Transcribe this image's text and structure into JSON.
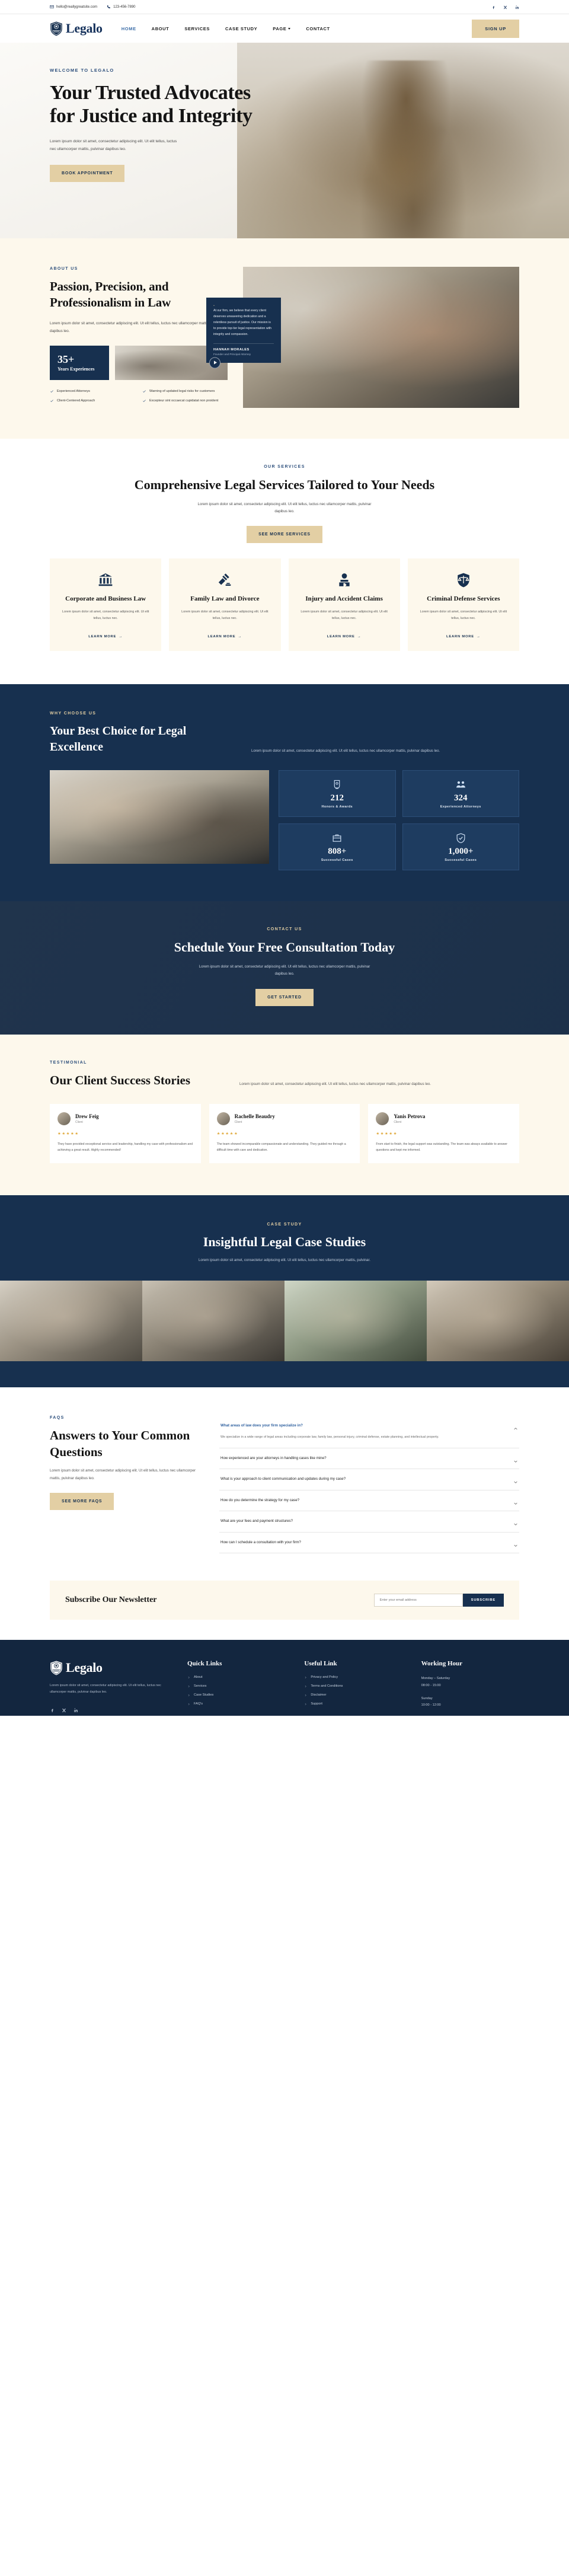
{
  "topbar": {
    "email": "hello@reallygreatsite.com",
    "phone": "123-456-7890",
    "socials": [
      "facebook-icon",
      "x-icon",
      "linkedin-icon"
    ]
  },
  "nav": {
    "brand": "Legalo",
    "links": [
      {
        "label": "HOME",
        "active": true
      },
      {
        "label": "ABOUT",
        "active": false
      },
      {
        "label": "SERVICES",
        "active": false
      },
      {
        "label": "CASE STUDY",
        "active": false
      },
      {
        "label": "PAGE",
        "active": false,
        "caret": true
      },
      {
        "label": "CONTACT",
        "active": false
      }
    ],
    "signup": "SIGN UP"
  },
  "hero": {
    "eyebrow": "WELCOME TO LEGALO",
    "title": "Your Trusted Advocates for Justice and Integrity",
    "body": "Lorem ipsum dolor sit amet, consectetur adipiscing elit. Ut elit tellus, luctus nec ullamcorper mattis, pulvinar dapibus leo.",
    "cta": "BOOK APPOINTMENT"
  },
  "about": {
    "label": "ABOUT US",
    "title": "Passion, Precision, and Professionalism in Law",
    "body": "Lorem ipsum dolor sit amet, consectetur adipiscing elit. Ut elit tellus, luctus nec ullamcorper mattis, pulvinar dapibus leo.",
    "experience_number": "35+",
    "experience_label": "Years Experiences",
    "checks": [
      "Experienced Attorneys",
      "Warning of updated legal risks for customers",
      "Client-Centered Approach",
      "Excepteur sint occaecat cupidatat non proident"
    ],
    "quote": {
      "mark": "“",
      "text": "At our firm, we believe that every client deserves unwavering dedication and a relentless pursuit of justice. Our mission is to provide top-tier legal representation with integrity and compassion.",
      "name": "HANNAH MORALES",
      "role": "Founder and Principal Attorney"
    }
  },
  "services": {
    "label": "OUR SERVICES",
    "title": "Comprehensive Legal Services Tailored to Your Needs",
    "body": "Lorem ipsum dolor sit amet, consectetur adipiscing elit. Ut elit tellus, luctus nec ullamcorper mattis, pulvinar dapibus leo.",
    "cta": "SEE MORE SERVICES",
    "cards": [
      {
        "icon": "bank-icon",
        "title": "Corporate and Business Law",
        "body": "Lorem ipsum dolor sit amet, consectetur adipiscing elit. Ut elit tellus, luctus nec.",
        "link": "LEARN MORE"
      },
      {
        "icon": "gavel-icon",
        "title": "Family Law and Divorce",
        "body": "Lorem ipsum dolor sit amet, consectetur adipiscing elit. Ut elit tellus, luctus nec.",
        "link": "LEARN MORE"
      },
      {
        "icon": "injury-icon",
        "title": "Injury and Accident Claims",
        "body": "Lorem ipsum dolor sit amet, consectetur adipiscing elit. Ut elit tellus, luctus nec.",
        "link": "LEARN MORE"
      },
      {
        "icon": "shield-scales-icon",
        "title": "Criminal Defense Services",
        "body": "Lorem ipsum dolor sit amet, consectetur adipiscing elit. Ut elit tellus, luctus nec.",
        "link": "LEARN MORE"
      }
    ]
  },
  "why": {
    "label": "WHY CHOOSE US",
    "title": "Your Best Choice for Legal Excellence",
    "body": "Lorem ipsum dolor sit amet, consectetur adipiscing elit. Ut elit tellus, luctus nec ullamcorper mattis, pulvinar dapibus leo.",
    "stats": [
      {
        "icon": "award-icon",
        "number": "212",
        "label": "Honors & Awards"
      },
      {
        "icon": "attorneys-icon",
        "number": "324",
        "label": "Experienced Attorneys"
      },
      {
        "icon": "case-icon",
        "number": "808+",
        "label": "Successful Cases"
      },
      {
        "icon": "badge-icon",
        "number": "1,000+",
        "label": "Successful Cases"
      }
    ]
  },
  "cta": {
    "label": "CONTACT US",
    "title": "Schedule Your Free Consultation Today",
    "body": "Lorem ipsum dolor sit amet, consectetur adipiscing elit. Ut elit tellus, luctus nec ullamcorper mattis, pulvinar dapibus leo.",
    "button": "GET STARTED"
  },
  "testimonial": {
    "label": "TESTIMONIAL",
    "title": "Our Client Success Stories",
    "body": "Lorem ipsum dolor sit amet, consectetur adipiscing elit. Ut elit tellus, luctus nec ullamcorper mattis, pulvinar dapibus leo.",
    "cards": [
      {
        "name": "Drew Feig",
        "role": "Client",
        "stars": "★★★★★",
        "text": "They have provided exceptional service and leadership, handling my case with professionalism and achieving a great result. Highly recommended!"
      },
      {
        "name": "Rachelle Beaudry",
        "role": "Client",
        "stars": "★★★★★",
        "text": "The team showed incomparable compassionate and understanding. They guided me through a difficult time with care and dedication."
      },
      {
        "name": "Yanis Petrova",
        "role": "Client",
        "stars": "★★★★★",
        "text": "From start to finish, the legal support was outstanding. The team was always available to answer questions and kept me informed."
      }
    ]
  },
  "case_study": {
    "label": "CASE STUDY",
    "title": "Insightful Legal Case Studies",
    "body": "Lorem ipsum dolor sit amet, consectetur adipiscing elit. Ut elit tellus, luctus nec ullamcorper mattis, pulvinar."
  },
  "faq": {
    "label": "FAQS",
    "title": "Answers to Your Common Questions",
    "body": "Lorem ipsum dolor sit amet, consectetur adipiscing elit. Ut elit tellus, luctus nec ullamcorper mattis, pulvinar dapibus leo.",
    "cta": "SEE MORE FAQS",
    "items": [
      {
        "q": "What areas of law does your firm specialize in?",
        "a": "We specialize in a wide range of legal areas including corporate law, family law, personal injury, criminal defense, estate planning, and intellectual property.",
        "open": true
      },
      {
        "q": "How experienced are your attorneys in handling cases like mine?",
        "a": "",
        "open": false
      },
      {
        "q": "What is your approach to client communication and updates during my case?",
        "a": "",
        "open": false
      },
      {
        "q": "How do you determine the strategy for my case?",
        "a": "",
        "open": false
      },
      {
        "q": "What are your fees and payment structures?",
        "a": "",
        "open": false
      },
      {
        "q": "How can I schedule a consultation with your firm?",
        "a": "",
        "open": false
      }
    ]
  },
  "newsletter": {
    "title": "Subscribe Our Newsletter",
    "placeholder": "Enter your email address",
    "button": "SUBSCRIBE"
  },
  "footer": {
    "brand": "Legalo",
    "about": "Lorem ipsum dolor sit amet, consectetur adipiscing elit. Ut elit tellus, luctus nec ullamcorper mattis, pulvinar dapibus leo.",
    "socials": [
      "facebook-icon",
      "x-icon",
      "linkedin-icon"
    ],
    "quick_links_title": "Quick Links",
    "quick_links": [
      "About",
      "Services",
      "Case Studies",
      "FAQ's"
    ],
    "useful_links_title": "Useful Link",
    "useful_links": [
      "Privacy and Policy",
      "Terms and Conditions",
      "Disclaimer",
      "Support"
    ],
    "hours_title": "Working Hour",
    "hours_line1": "Monday – Saturday",
    "hours_line2": "08:00 - 15:00",
    "hours_line3": "Sunday",
    "hours_line4": "10:00 - 12:00"
  },
  "colors": {
    "navy": "#17304f",
    "gold": "#e3cfa4",
    "cream": "#fdf8ec",
    "accent_blue": "#3d6ea8"
  }
}
